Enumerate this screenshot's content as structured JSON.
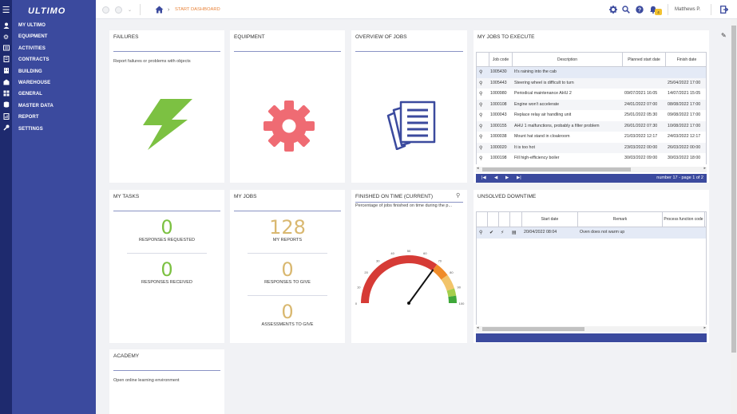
{
  "app": {
    "logo_text": "ULTIMO"
  },
  "nav": [
    {
      "label": "MY ULTIMO",
      "icon": "user-icon"
    },
    {
      "label": "EQUIPMENT",
      "icon": "gear-icon"
    },
    {
      "label": "ACTIVITIES",
      "icon": "activities-icon"
    },
    {
      "label": "CONTRACTS",
      "icon": "contracts-icon"
    },
    {
      "label": "BUILDING",
      "icon": "building-icon"
    },
    {
      "label": "WAREHOUSE",
      "icon": "warehouse-icon"
    },
    {
      "label": "GENERAL",
      "icon": "grid-icon"
    },
    {
      "label": "MASTER DATA",
      "icon": "database-icon"
    },
    {
      "label": "REPORT",
      "icon": "report-icon"
    },
    {
      "label": "SETTINGS",
      "icon": "wrench-icon"
    }
  ],
  "header": {
    "breadcrumb": "START DASHBOARD",
    "user_name": "Matthews P.",
    "notification_count": "4"
  },
  "tiles": {
    "failures": {
      "title": "FAILURES",
      "subtitle": "Report failures or problems with objects"
    },
    "equipment": {
      "title": "EQUIPMENT"
    },
    "overview_jobs": {
      "title": "OVERVIEW OF JOBS"
    },
    "my_tasks": {
      "title": "MY TASKS",
      "stats": [
        {
          "value": "0",
          "label": "RESPONSES REQUESTED"
        },
        {
          "value": "0",
          "label": "RESPONSES RECEIVED"
        }
      ]
    },
    "my_jobs": {
      "title": "MY JOBS",
      "stats": [
        {
          "value": "128",
          "label": "MY REPORTS"
        },
        {
          "value": "0",
          "label": "RESPONSES TO GIVE"
        },
        {
          "value": "0",
          "label": "ASSESSMENTS TO GIVE"
        }
      ]
    },
    "finished_on_time": {
      "title": "FINISHED ON TIME (CURRENT)",
      "subtitle": "Percentage of jobs finished on time during the p...",
      "gauge": {
        "value": 70,
        "min": 0,
        "max": 100,
        "ticks": [
          "0",
          "10",
          "20",
          "30",
          "40",
          "50",
          "60",
          "70",
          "80",
          "90",
          "100"
        ],
        "bands": [
          {
            "from": 0,
            "to": 70,
            "color": "#d63b36"
          },
          {
            "from": 70,
            "to": 80,
            "color": "#f08c2a"
          },
          {
            "from": 80,
            "to": 90,
            "color": "#f2c46a"
          },
          {
            "from": 90,
            "to": 95,
            "color": "#a5cf4c"
          },
          {
            "from": 95,
            "to": 100,
            "color": "#3fa83a"
          }
        ]
      }
    },
    "academy": {
      "title": "ACADEMY",
      "subtitle": "Open online learning environment"
    }
  },
  "my_jobs_to_execute": {
    "title": "MY JOBS TO EXECUTE",
    "columns": [
      "Job code",
      "Description",
      "Planned start date",
      "Finish date"
    ],
    "rows": [
      {
        "code": "1005430",
        "description": "It's raining into the cab",
        "start": "",
        "finish": ""
      },
      {
        "code": "1005443",
        "description": "Steering wheel is difficult to turn",
        "start": "",
        "finish": "25/04/2022 17:00"
      },
      {
        "code": "1000980",
        "description": "Periodical maintenance AHU 2",
        "start": "09/07/2021 16:05",
        "finish": "14/07/2021 15:05"
      },
      {
        "code": "1000108",
        "description": "Engine won't accelerate",
        "start": "24/01/2022 07:00",
        "finish": "08/08/2022 17:00"
      },
      {
        "code": "1000043",
        "description": "Replace relay air handling unit",
        "start": "25/01/2022 05:30",
        "finish": "09/08/2022 17:00"
      },
      {
        "code": "1000155",
        "description": "AHU 1 malfunctions, probably a filter problem",
        "start": "26/01/2022 07:30",
        "finish": "10/08/2022 17:00"
      },
      {
        "code": "1000038",
        "description": "Mount hat stand in cloakroom",
        "start": "21/03/2022 12:17",
        "finish": "24/03/2022 12:17"
      },
      {
        "code": "1000020",
        "description": "It is too hot",
        "start": "23/03/2022 00:00",
        "finish": "26/03/2022 00:00"
      },
      {
        "code": "1000198",
        "description": "Fill high-efficiency boiler",
        "start": "30/03/2022 09:00",
        "finish": "30/03/2022 18:00"
      }
    ],
    "pager_text": "number 17 - page 1 of 2"
  },
  "unsolved_downtime": {
    "title": "UNSOLVED DOWNTIME",
    "columns": [
      "Start date",
      "Remark",
      "Process function code"
    ],
    "rows": [
      {
        "start": "20/04/2022 08:04",
        "remark": "Oven does not warm up"
      }
    ]
  },
  "colors": {
    "sidebar": "#3b4a9e",
    "rail": "#1e2a6e",
    "accent_orange": "#e8833a",
    "stat_green": "#7cc142",
    "stat_gold": "#d9b870",
    "failures_icon": "#7cc142",
    "equipment_icon": "#ef6b73",
    "jobs_icon": "#3b4a9e"
  }
}
